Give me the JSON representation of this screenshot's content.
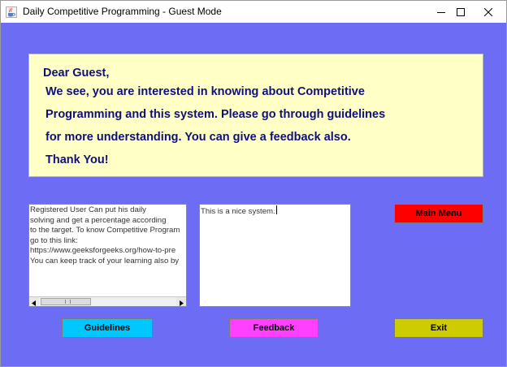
{
  "window": {
    "title": "Daily Competitive Programming - Guest Mode"
  },
  "message": {
    "greeting": "Dear Guest,",
    "line1": "We see, you are interested in knowing about Competitive",
    "line2": "Programming and this system. Please go through guidelines",
    "line3": "for more understanding. You can give a feedback also.",
    "line4": "Thank You!"
  },
  "guidelines_text": "Registered User Can put his daily\nsolving and get a percentage according\nto the target. To know Competitive Program\ngo to this link:\nhttps://www.geeksforgeeks.org/how-to-pre\nYou can keep track of your learning also by",
  "feedback_text": "This is a nice system.",
  "buttons": {
    "main_menu": "Main Menu",
    "guidelines": "Guidelines",
    "feedback": "Feedback",
    "exit": "Exit"
  },
  "colors": {
    "background": "#6c6cf4",
    "message_panel": "#ffffc6",
    "message_text": "#10107a",
    "main_menu": "#ff0000",
    "guidelines": "#00c8ff",
    "feedback": "#ff40ff",
    "exit": "#cccc00"
  },
  "icons": {
    "app": "java-coffee-icon",
    "minimize": "minimize-icon",
    "maximize": "maximize-icon",
    "close": "close-icon"
  }
}
